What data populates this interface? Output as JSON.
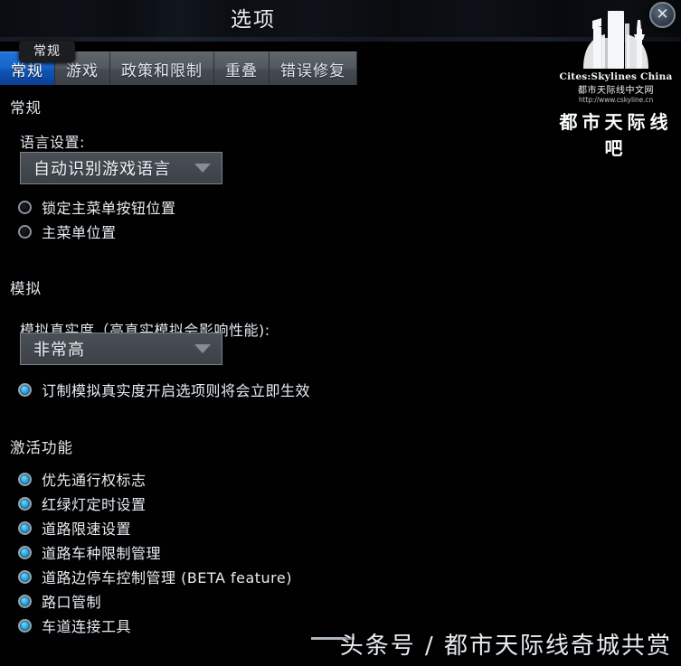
{
  "window": {
    "title": "选项",
    "close_icon": "close-icon"
  },
  "logo": {
    "en_name": "Cites:Skylines China",
    "cn_name": "都市天际线中文网",
    "url": "http://www.cskyline.cn",
    "big_text": "都市天际线吧"
  },
  "tooltip": {
    "text": "常规"
  },
  "tabs": [
    {
      "label": "常规",
      "active": true
    },
    {
      "label": "游戏",
      "active": false
    },
    {
      "label": "政策和限制",
      "active": false
    },
    {
      "label": "重叠",
      "active": false
    },
    {
      "label": "错误修复",
      "active": false
    }
  ],
  "sections": {
    "general": {
      "title": "常规",
      "language_label": "语言设置:",
      "language_value": "自动识别游戏语言",
      "options": [
        {
          "label": "锁定主菜单按钮位置",
          "checked": false
        },
        {
          "label": "主菜单位置",
          "checked": false
        }
      ]
    },
    "simulation": {
      "title": "模拟",
      "accuracy_label": "模拟真实度（高真实模拟会影响性能):",
      "accuracy_value": "非常高",
      "options": [
        {
          "label": "订制模拟真实度开启选项则将会立即生效",
          "checked": true
        }
      ]
    },
    "features": {
      "title": "激活功能",
      "options": [
        {
          "label": "优先通行权标志",
          "checked": true
        },
        {
          "label": "红绿灯定时设置",
          "checked": true
        },
        {
          "label": "道路限速设置",
          "checked": true
        },
        {
          "label": "道路车种限制管理",
          "checked": true
        },
        {
          "label": "道路边停车控制管理 (BETA feature)",
          "checked": true
        },
        {
          "label": "路口管制",
          "checked": true
        },
        {
          "label": "车道连接工具",
          "checked": true
        }
      ]
    }
  },
  "watermark": {
    "text": "头条号 / 都市天际线奇城共赏"
  },
  "colors": {
    "accent_blue": "#1766cd",
    "radio_on": "#2aa9e2",
    "panel_bg": "#010101",
    "dropdown_bg": "#43484f"
  }
}
